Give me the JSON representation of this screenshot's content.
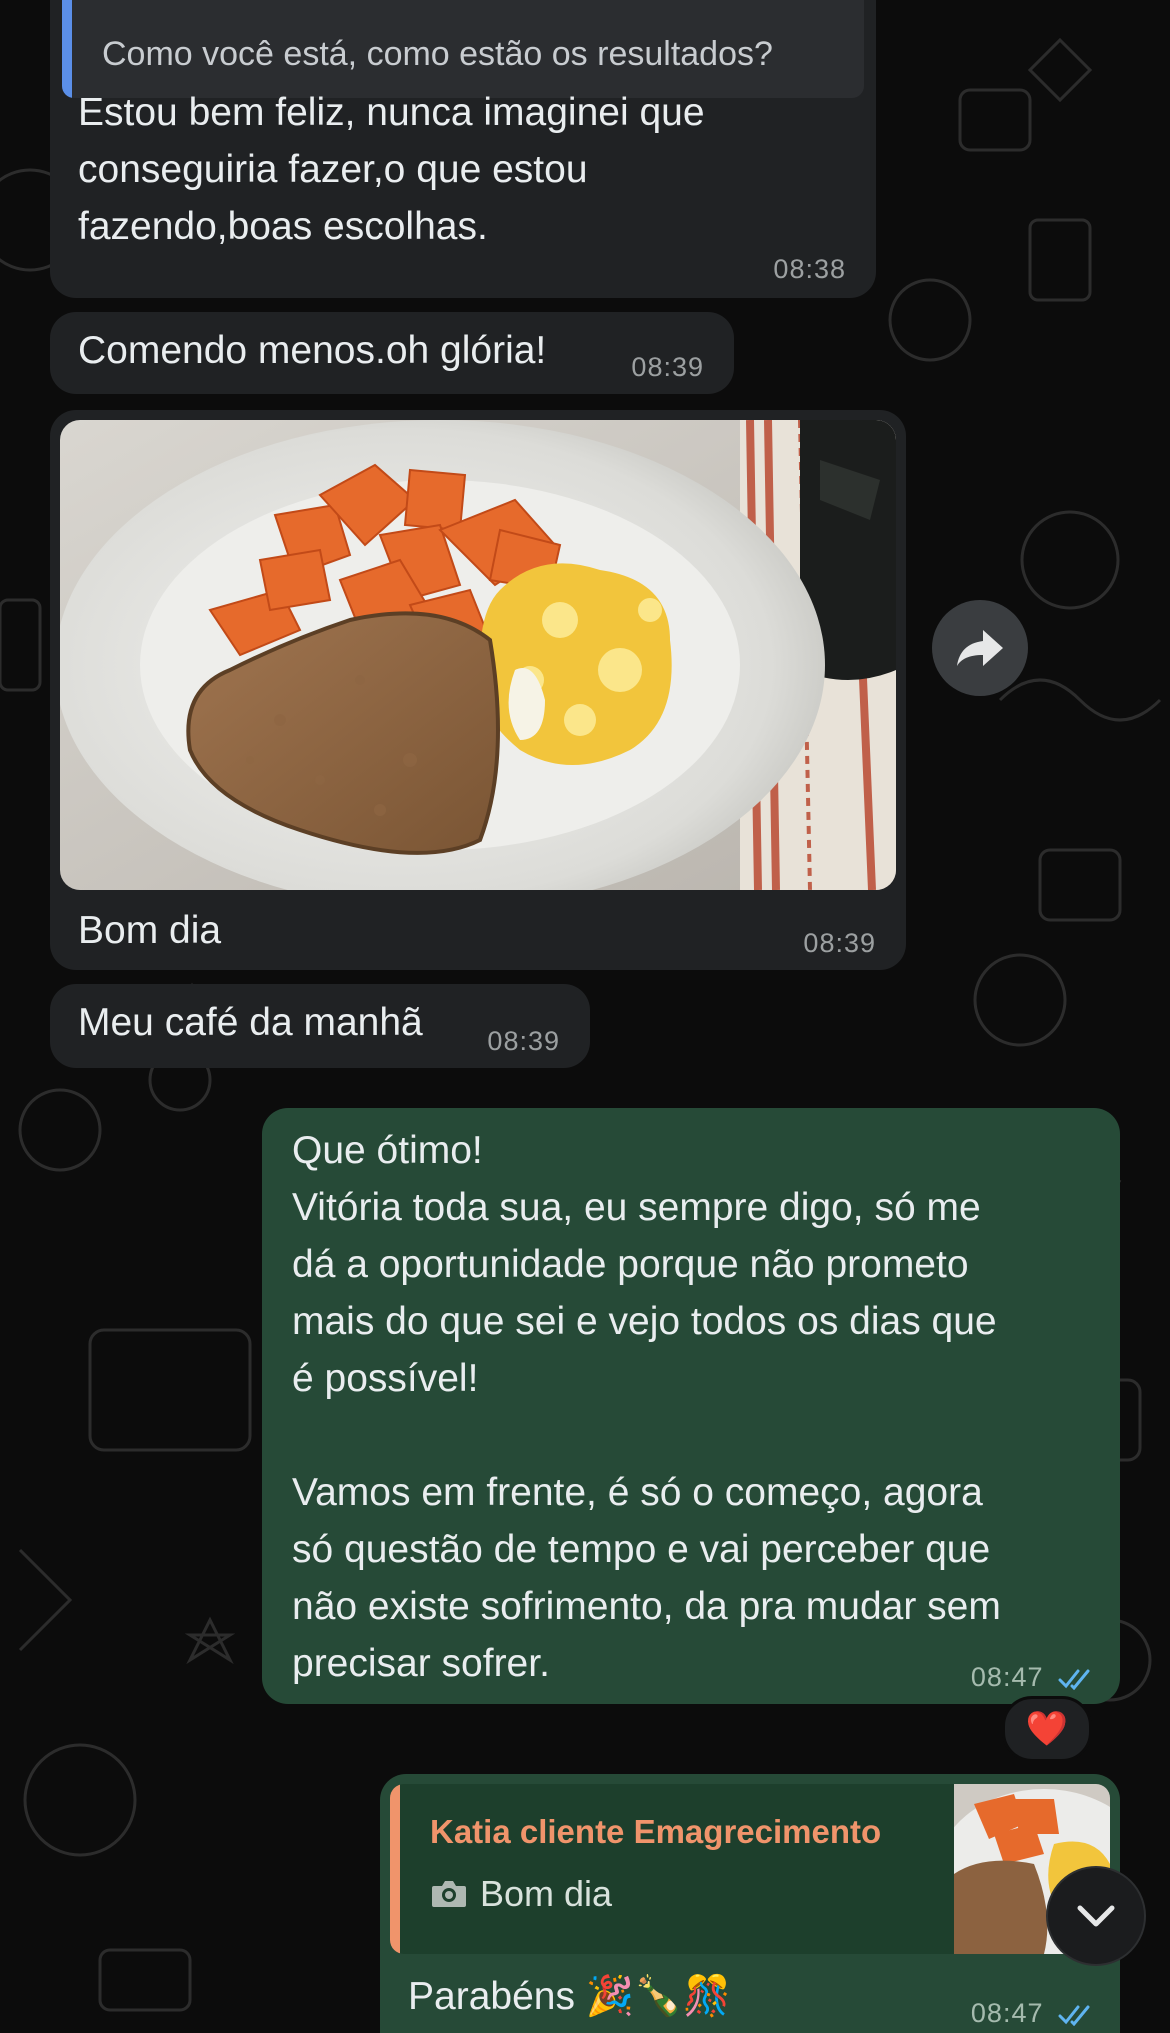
{
  "chat": {
    "quoted_text": "Como você está, como estão os resultados?",
    "messages": [
      {
        "text": "Estou bem feliz, nunca imaginei que\nconseguiria fazer,o que estou\nfazendo,boas escolhas.",
        "time": "08:38"
      },
      {
        "text": "Comendo menos.oh glória!",
        "time": "08:39"
      },
      {
        "caption": "Bom dia",
        "time": "08:39"
      },
      {
        "text": "Meu café da manhã",
        "time": "08:39"
      },
      {
        "text": "Que ótimo!\nVitória toda sua, eu sempre digo, só me\ndá a oportunidade porque não prometo\nmais do que sei e vejo todos os dias que\né possível!\n\nVamos em frente, é só o começo, agora\nsó questão de tempo e vai perceber que\nnão existe sofrimento, da pra mudar sem\nprecisar sofrer.",
        "time": "08:47",
        "reaction": "❤️"
      },
      {
        "reply_author": "Katia cliente Emagrecimento",
        "reply_caption": "Bom dia",
        "text": "Parabéns 🎉🍾🎊",
        "time": "08:47"
      }
    ]
  },
  "icons": {
    "forward": "forward-arrow-icon",
    "scroll_down": "chevron-down-icon",
    "camera": "camera-icon",
    "read": "double-check-icon"
  },
  "colors": {
    "background": "#0c0c0c",
    "incoming_bubble": "#202224",
    "outgoing_bubble": "#264a37",
    "quote_accent": "#5b8fe8",
    "reply_accent": "#f0946b",
    "read_ticks": "#5fb4f0"
  }
}
